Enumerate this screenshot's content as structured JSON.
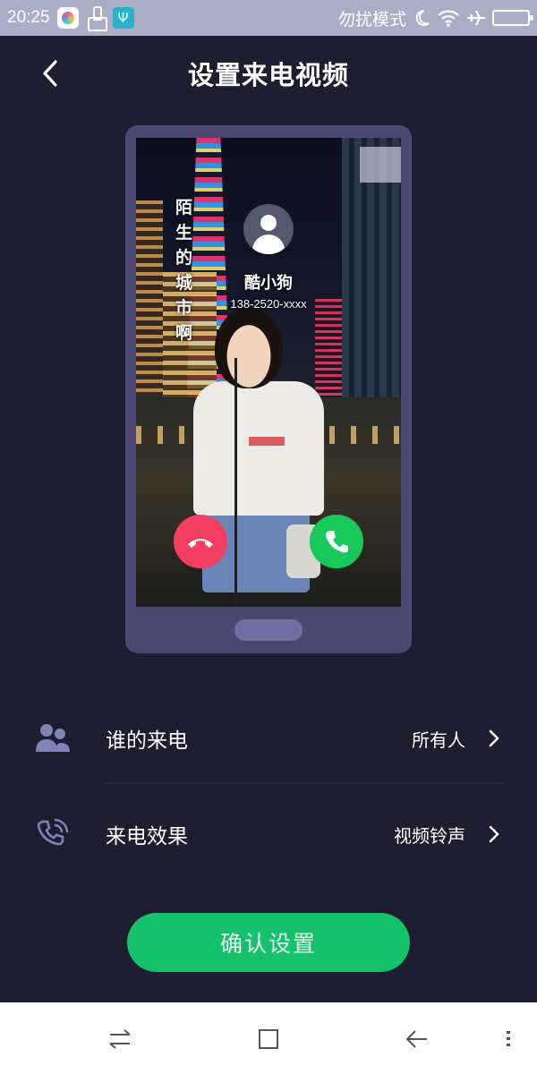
{
  "status_bar": {
    "time": "20:25",
    "dnd_label": "勿扰模式",
    "icons": [
      "app-icon",
      "cleaner-icon",
      "usb-icon",
      "moon-icon",
      "wifi-icon",
      "airplane-icon",
      "battery-icon"
    ]
  },
  "header": {
    "title": "设置来电视频",
    "back_icon": "chevron-left-icon"
  },
  "preview": {
    "lyric": "陌生的城市啊",
    "caller_name": "酷小狗",
    "caller_number": "138-2520-xxxx",
    "decline_color": "#f23e60",
    "accept_color": "#18c85a"
  },
  "settings": {
    "items": [
      {
        "label": "谁的来电",
        "value": "所有人",
        "icon": "contacts-icon"
      },
      {
        "label": "来电效果",
        "value": "视频铃声",
        "icon": "phone-ring-icon"
      }
    ]
  },
  "confirm": {
    "label": "确认设置",
    "color": "#15c16b"
  },
  "nav_bar": {
    "icons": [
      "switch-icon",
      "home-square-icon",
      "back-arrow-icon",
      "menu-dots-icon"
    ]
  }
}
